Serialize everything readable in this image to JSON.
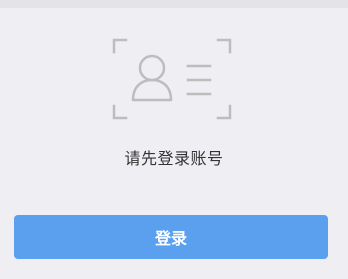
{
  "illustration": {
    "icon": "id-card-icon",
    "stroke_color": "#bdbdbd"
  },
  "prompt": {
    "text": "请先登录账号"
  },
  "login_button": {
    "label": "登录",
    "color": "#5aa0ef"
  }
}
